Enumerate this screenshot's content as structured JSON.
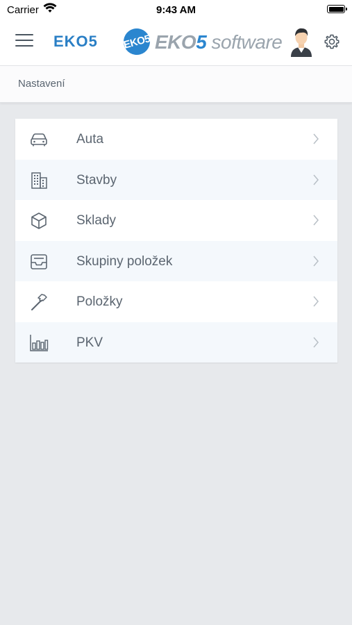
{
  "status_bar": {
    "carrier": "Carrier",
    "time": "9:43 AM"
  },
  "header": {
    "app_title": "EKO5",
    "logo": {
      "badge": "EKO5",
      "text_part1": "EKO",
      "text_part2": "5",
      "text_part3": " software"
    },
    "icons": {
      "menu": "hamburger-menu-icon",
      "avatar": "user-avatar",
      "settings": "gear-icon"
    }
  },
  "breadcrumb": "Nastavení",
  "menu": {
    "items": [
      {
        "label": "Auta",
        "icon": "car-icon"
      },
      {
        "label": "Stavby",
        "icon": "building-icon"
      },
      {
        "label": "Sklady",
        "icon": "box-icon"
      },
      {
        "label": "Skupiny položek",
        "icon": "inbox-tray-icon"
      },
      {
        "label": "Položky",
        "icon": "hammer-icon"
      },
      {
        "label": "PKV",
        "icon": "bar-chart-icon"
      }
    ]
  },
  "colors": {
    "accent": "#2b86cf",
    "background": "#e7e9ec",
    "row_alt": "#f4f8fc",
    "text": "#5b6570"
  }
}
